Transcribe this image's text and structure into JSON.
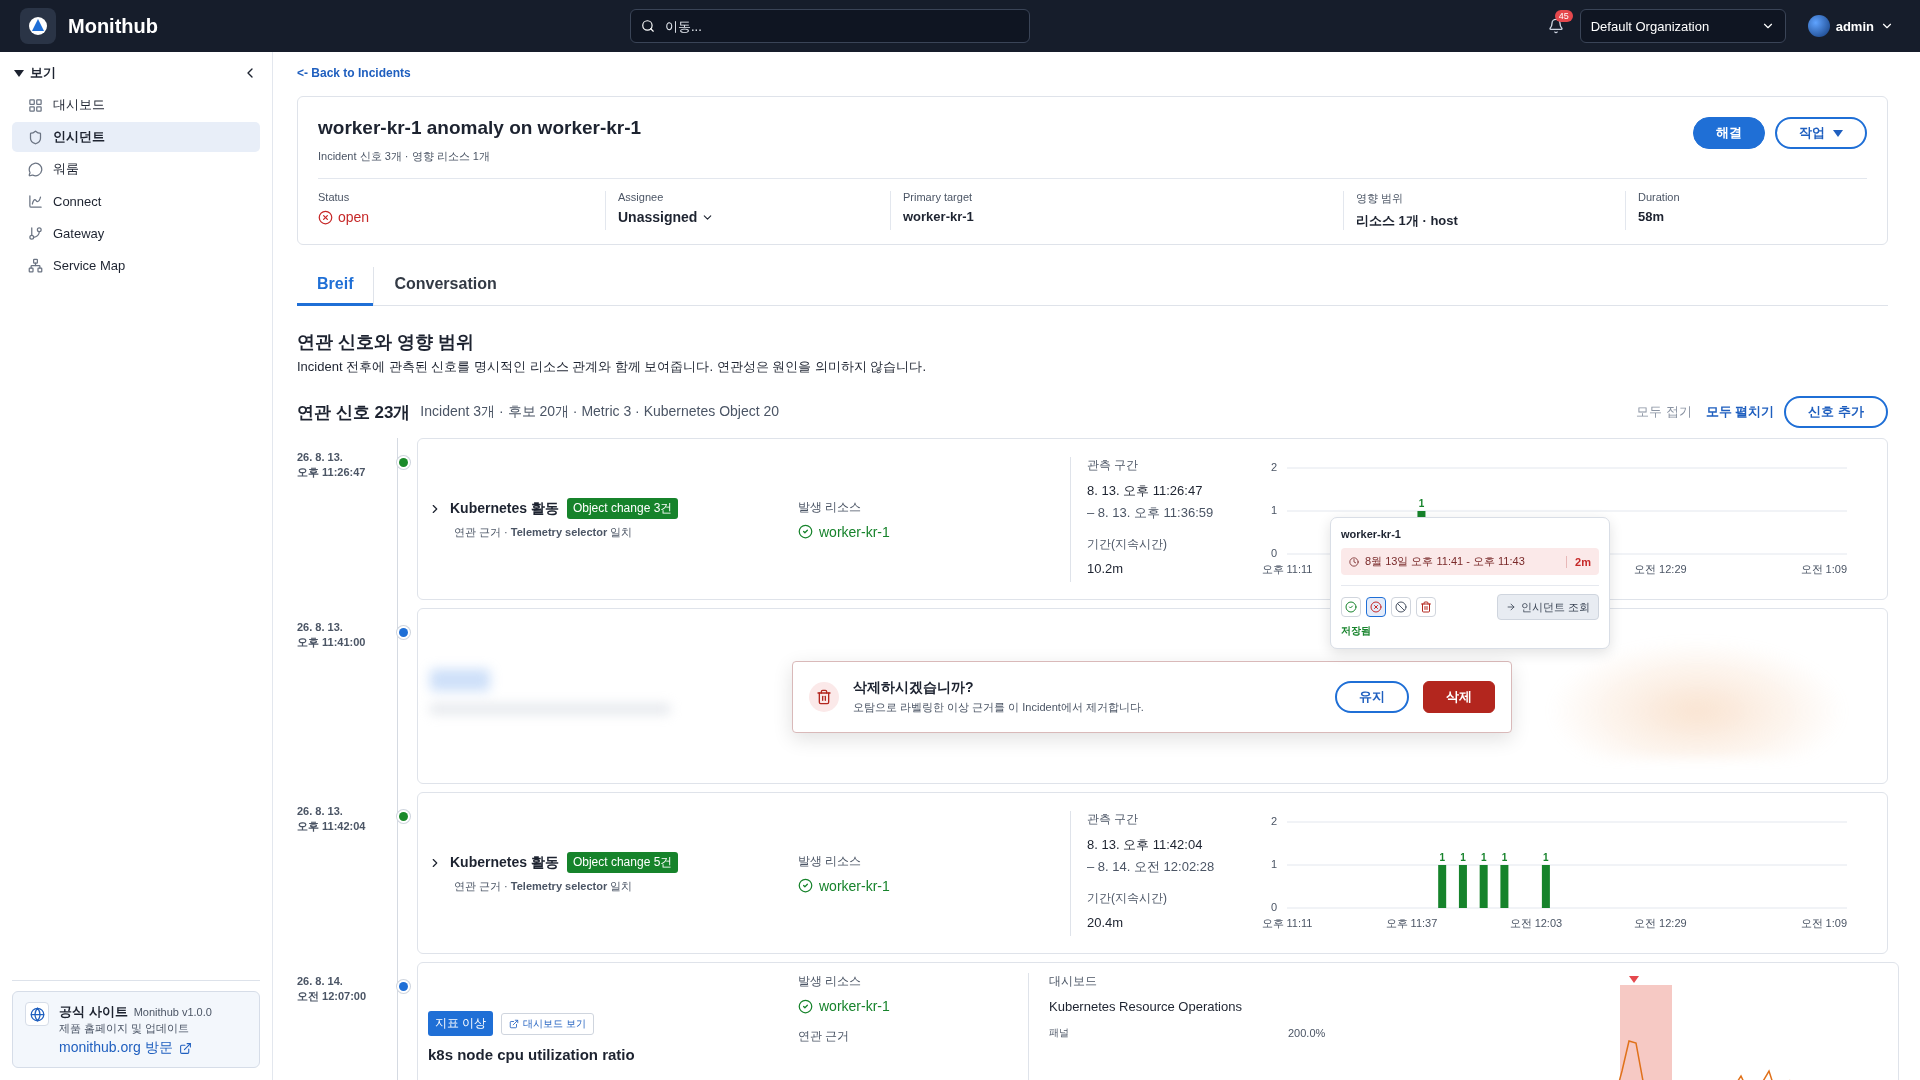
{
  "app": {
    "name": "Monithub"
  },
  "search": {
    "placeholder": "이동..."
  },
  "notifications": {
    "count": "45"
  },
  "organization": {
    "value": "Default Organization"
  },
  "user": {
    "name": "admin"
  },
  "sidebar": {
    "section": "보기",
    "expanded": true,
    "items": [
      {
        "kind": "grid",
        "label": "대시보드",
        "selected": false
      },
      {
        "kind": "shield",
        "label": "인시던트",
        "selected": true
      },
      {
        "kind": "chat",
        "label": "워룸",
        "selected": false
      },
      {
        "kind": "connect",
        "label": "Connect",
        "selected": false
      },
      {
        "kind": "gateway",
        "label": "Gateway",
        "selected": false
      },
      {
        "kind": "map",
        "label": "Service Map",
        "selected": false
      }
    ],
    "promo": {
      "title": "공식 사이트",
      "version": "Monithub v1.0.0",
      "subtitle": "제품 홈페이지 및 업데이트",
      "link": "monithub.org 방문"
    }
  },
  "back_link": "<- Back to Incidents",
  "incident": {
    "title": "worker-kr-1 anomaly on worker-kr-1",
    "subtitle": "Incident 신호 3개 · 영향 리소스 1개",
    "resolve": "해결",
    "actions": "작업",
    "fields": [
      {
        "kind": "status",
        "label": "Status",
        "value": "open"
      },
      {
        "kind": "select",
        "label": "Assignee",
        "value": "Unassigned"
      },
      {
        "kind": "text",
        "label": "Primary target",
        "value": "worker-kr-1"
      },
      {
        "kind": "text",
        "label": "영향 범위",
        "value": "리소스 1개 · host"
      },
      {
        "kind": "text",
        "label": "Duration",
        "value": "58m"
      }
    ]
  },
  "tabs": [
    {
      "label": "Breif",
      "selected": true
    },
    {
      "label": "Conversation",
      "selected": false
    }
  ],
  "section": {
    "title": "연관 신호와 영향 범위",
    "description": "Incident 전후에 관측된 신호를 명시적인 리소스 관계와 함께 보여줍니다. 연관성은 원인을 의미하지 않습니다."
  },
  "signals": {
    "title": "연관 신호 23개",
    "summary": "Incident 3개 · 후보 20개 · Metric 3 · Kubernetes Object 20",
    "collapse_all": "모두 접기",
    "expand_all": "모두 펼치기",
    "add": "신호 추가",
    "items": [
      {
        "kind": "k8s",
        "date": "26. 8. 13.",
        "time": "오후 11:26:47",
        "color": "#1a8a2a",
        "title": "Kubernetes 활동",
        "badge": "Object change 3건",
        "evidence": "연관 근거 · **Telemetry selector** 일치",
        "resource_label": "발생 리소스",
        "resource": "worker-kr-1",
        "window_label": "관측 구간",
        "window_start": "8. 13. 오후 11:26:47",
        "window_end": "– 8. 13. 오후 11:36:59",
        "duration_label": "기간(지속시간)",
        "duration": "10.2m",
        "chart_data": {
          "type": "bar",
          "categories": [
            "오후 11:11",
            null,
            null,
            null,
            null,
            null,
            null,
            null,
            null,
            null,
            null,
            null,
            null,
            null,
            null,
            null,
            null,
            null,
            "오전 12:29",
            null,
            null,
            null,
            null,
            null,
            null,
            null,
            null,
            "오전 1:09"
          ],
          "values": [
            null,
            null,
            null,
            null,
            null,
            null,
            1,
            null,
            null,
            null,
            null,
            null,
            null,
            null,
            null,
            null,
            null,
            null,
            null,
            null,
            null,
            null,
            null,
            null,
            null,
            null,
            null,
            null
          ],
          "ylim": [
            0,
            2
          ],
          "yticks": [
            0,
            1,
            2
          ],
          "data_labels": true
        },
        "tooltip": {
          "title": "worker-kr-1",
          "range": "8월 13일 오후 11:41 - 오후 11:43",
          "length": "2m",
          "actions": [
            {
              "kind": "confirm",
              "selected": false
            },
            {
              "kind": "reject",
              "selected": true
            },
            {
              "kind": "ignore",
              "selected": false
            },
            {
              "kind": "delete",
              "selected": false
            }
          ],
          "status": "저장됨",
          "open": "인시던트 조회"
        }
      },
      {
        "kind": "blurred",
        "date": "26. 8. 13.",
        "time": "오후 11:41:00",
        "color": "#1f6fd6",
        "dialog": {
          "title": "삭제하시겠습니까?",
          "message": "오탐으로 라벨링한 이상 근거를 이 Incident에서 제거합니다.",
          "keep": "유지",
          "delete": "삭제"
        }
      },
      {
        "kind": "k8s",
        "date": "26. 8. 13.",
        "time": "오후 11:42:04",
        "color": "#1a8a2a",
        "title": "Kubernetes 활동",
        "badge": "Object change 5건",
        "evidence": "연관 근거 · **Telemetry selector** 일치",
        "resource_label": "발생 리소스",
        "resource": "worker-kr-1",
        "window_label": "관측 구간",
        "window_start": "8. 13. 오후 11:42:04",
        "window_end": "– 8. 14. 오전 12:02:28",
        "duration_label": "기간(지속시간)",
        "duration": "20.4m",
        "chart_data": {
          "type": "bar",
          "categories": [
            "오후 11:11",
            null,
            null,
            null,
            null,
            null,
            "오후 11:37",
            null,
            null,
            null,
            null,
            null,
            "오전 12:03",
            null,
            null,
            null,
            null,
            null,
            "오전 12:29",
            null,
            null,
            null,
            null,
            null,
            null,
            null,
            null,
            "오전 1:09"
          ],
          "values": [
            null,
            null,
            null,
            null,
            null,
            null,
            null,
            1,
            1,
            1,
            1,
            null,
            1,
            null,
            null,
            null,
            null,
            null,
            null,
            null,
            null,
            null,
            null,
            null,
            null,
            null,
            null,
            null
          ],
          "ylim": [
            0,
            2
          ],
          "yticks": [
            0,
            1,
            2
          ],
          "data_labels": true
        }
      },
      {
        "kind": "metric",
        "date": "26. 8. 14.",
        "time": "오전 12:07:00",
        "color": "#1f6fd6",
        "badge": "지표 이상",
        "link": "대시보드 보기",
        "title": "k8s node cpu utilization ratio",
        "resource_label": "발생 리소스",
        "resource": "worker-kr-1",
        "evidence_label": "연관 근거",
        "dashboard_label": "대시보드",
        "dashboard": "Kubernetes Resource Operations",
        "panel_label": "패널",
        "y_label": "200.0%"
      }
    ]
  }
}
